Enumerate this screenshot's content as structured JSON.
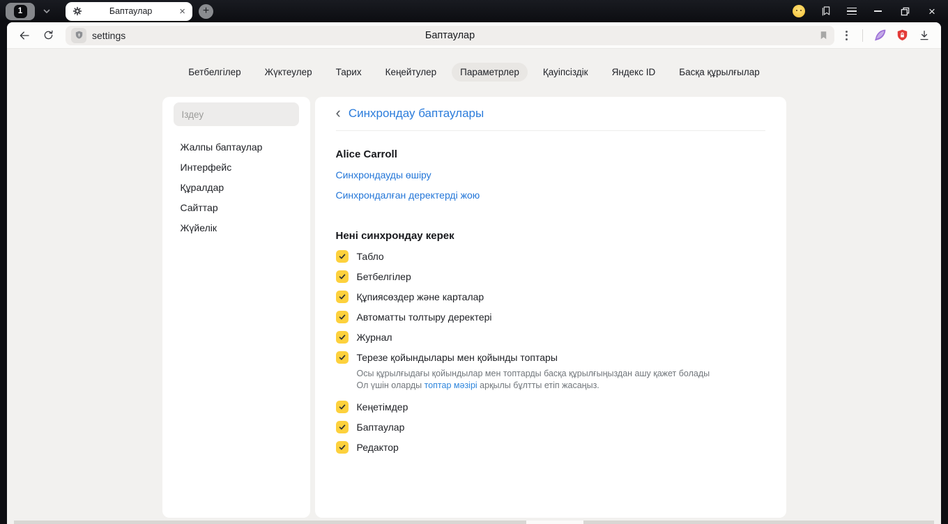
{
  "window": {
    "tab_count": "1",
    "tab_title": "Баптаулар",
    "new_tab_label": "+",
    "close_tab_label": "×",
    "close_window_label": "×"
  },
  "toolbar": {
    "url_text": "settings",
    "page_title": "Баптаулар"
  },
  "nav": {
    "tabs": [
      {
        "label": "Бетбелгілер",
        "active": false
      },
      {
        "label": "Жүктеулер",
        "active": false
      },
      {
        "label": "Тарих",
        "active": false
      },
      {
        "label": "Кеңейтулер",
        "active": false
      },
      {
        "label": "Параметрлер",
        "active": true
      },
      {
        "label": "Қауіпсіздік",
        "active": false
      },
      {
        "label": "Яндекс ID",
        "active": false
      },
      {
        "label": "Басқа құрылғылар",
        "active": false
      }
    ]
  },
  "sidebar": {
    "search_placeholder": "Іздеу",
    "items": [
      "Жалпы баптаулар",
      "Интерфейс",
      "Құралдар",
      "Сайттар",
      "Жүйелік"
    ]
  },
  "main": {
    "back_chevron": "‹",
    "heading": "Синхрондау баптаулары",
    "account_name": "Alice Carroll",
    "links": [
      "Синхрондауды өшіру",
      "Синхрондалған деректерді жою"
    ],
    "section_title": "Нені синхрондау керек",
    "sync_items": [
      {
        "label": "Табло",
        "checked": true
      },
      {
        "label": "Бетбелгілер",
        "checked": true
      },
      {
        "label": "Құпиясөздер және карталар",
        "checked": true
      },
      {
        "label": "Автоматты толтыру деректері",
        "checked": true
      },
      {
        "label": "Журнал",
        "checked": true
      },
      {
        "label": "Терезе қойындылары мен қойынды топтары",
        "checked": true,
        "description": {
          "line1": "Осы құрылғыдағы қойындылар мен топтарды басқа құрылғыңыздан ашу қажет болады",
          "line2_prefix": "Ол үшін оларды ",
          "line2_link": "топтар мәзірі",
          "line2_suffix": " арқылы бұлтты етіп жасаңыз."
        }
      },
      {
        "label": "Кеңетімдер",
        "checked": true
      },
      {
        "label": "Баптаулар",
        "checked": true
      },
      {
        "label": "Редактор",
        "checked": true
      }
    ]
  },
  "colors": {
    "accent_blue": "#2b7cdb",
    "checkbox_yellow": "#fdd13d",
    "shield_red": "#e33b38",
    "feather_purple": "#9b6ed6",
    "titlebar_dark": "#0c0d11",
    "page_background": "#f2f1ef"
  }
}
